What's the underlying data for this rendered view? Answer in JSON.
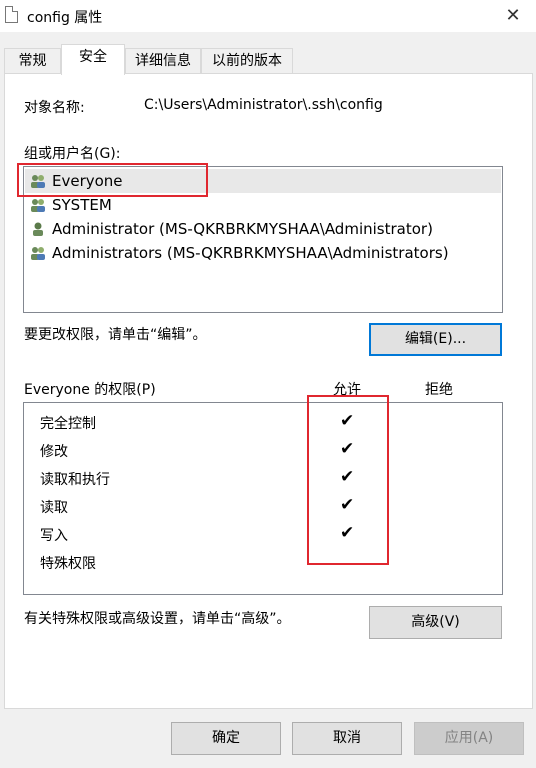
{
  "window": {
    "title": "config 属性",
    "close_symbol": "✕"
  },
  "tabs": [
    {
      "label": "常规",
      "active": false
    },
    {
      "label": "安全",
      "active": true
    },
    {
      "label": "详细信息",
      "active": false
    },
    {
      "label": "以前的版本",
      "active": false
    }
  ],
  "object": {
    "label": "对象名称:",
    "value": "C:\\Users\\Administrator\\.ssh\\config"
  },
  "groups": {
    "label": "组或用户名(G):",
    "items": [
      {
        "name": "Everyone",
        "icon": "group-users-icon",
        "selected": true
      },
      {
        "name": "SYSTEM",
        "icon": "group-users-icon",
        "selected": false
      },
      {
        "name": "Administrator (MS-QKRBRKMYSHAA\\Administrator)",
        "icon": "user-icon",
        "selected": false
      },
      {
        "name": "Administrators (MS-QKRBRKMYSHAA\\Administrators)",
        "icon": "group-users-icon",
        "selected": false
      }
    ]
  },
  "edit_hint": "要更改权限，请单击“编辑”。",
  "edit_button": "编辑(E)...",
  "permissions": {
    "label": "Everyone 的权限(P)",
    "allow_header": "允许",
    "deny_header": "拒绝",
    "items": [
      {
        "name": "完全控制",
        "allow": true,
        "deny": false
      },
      {
        "name": "修改",
        "allow": true,
        "deny": false
      },
      {
        "name": "读取和执行",
        "allow": true,
        "deny": false
      },
      {
        "name": "读取",
        "allow": true,
        "deny": false
      },
      {
        "name": "写入",
        "allow": true,
        "deny": false
      },
      {
        "name": "特殊权限",
        "allow": false,
        "deny": false
      }
    ],
    "check_symbol": "✔"
  },
  "advanced_hint": "有关特殊权限或高级设置，请单击“高级”。",
  "advanced_button": "高级(V)",
  "footer": {
    "ok": "确定",
    "cancel": "取消",
    "apply": "应用(A)"
  },
  "colors": {
    "highlight_box": "#e0272f",
    "accent": "#0078d7"
  }
}
